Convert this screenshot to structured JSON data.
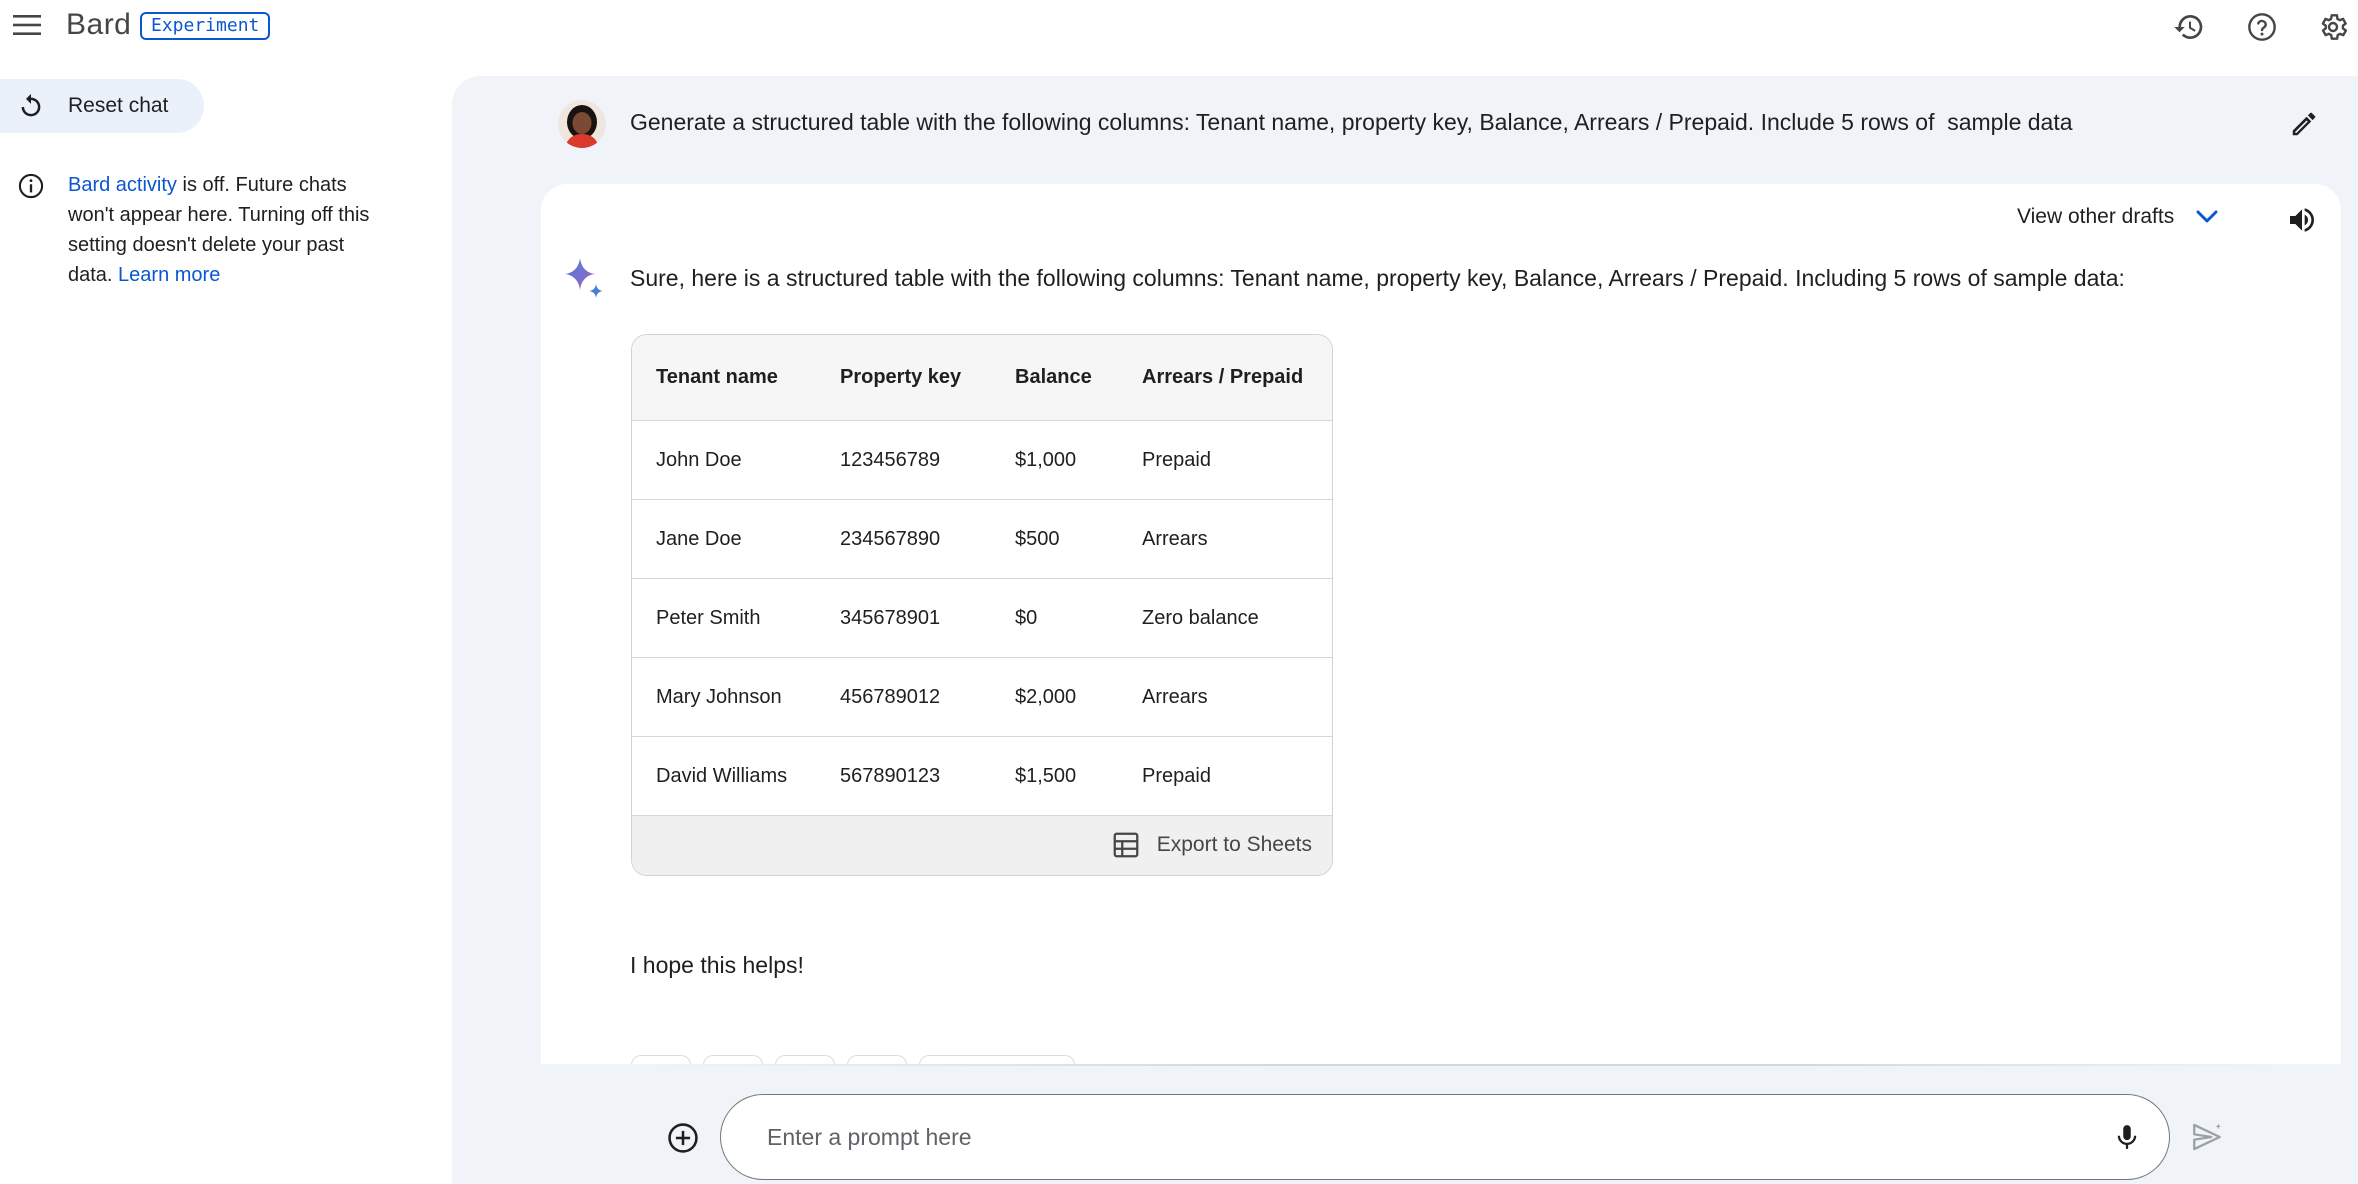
{
  "header": {
    "menu_icon": "hamburger-menu-icon",
    "brand": "Bard",
    "badge": "Experiment",
    "icons": [
      "history-icon",
      "help-icon",
      "settings-icon"
    ]
  },
  "sidebar": {
    "reset_label": "Reset chat",
    "activity_link": "Bard activity",
    "activity_text": " is off. Future chats won't appear here. Turning off this setting doesn't delete your past data. ",
    "learn_more": "Learn more"
  },
  "chat": {
    "user_prompt": "Generate a structured table with the following columns: Tenant name, property key, Balance, Arrears / Prepaid. Include 5 rows of  sample data",
    "drafts_label": "View other drafts",
    "response_intro": "Sure, here is a structured table with the following columns: Tenant name, property key, Balance, Arrears / Prepaid. Including 5 rows of sample data:",
    "table": {
      "headers": [
        "Tenant name",
        "Property key",
        "Balance",
        "Arrears / Prepaid"
      ],
      "rows": [
        [
          "John Doe",
          "123456789",
          "$1,000",
          "Prepaid"
        ],
        [
          "Jane Doe",
          "234567890",
          "$500",
          "Arrears"
        ],
        [
          "Peter Smith",
          "345678901",
          "$0",
          "Zero balance"
        ],
        [
          "Mary Johnson",
          "456789012",
          "$2,000",
          "Arrears"
        ],
        [
          "David Williams",
          "567890123",
          "$1,500",
          "Prepaid"
        ]
      ],
      "export_label": "Export to Sheets"
    },
    "response_outro": "I hope this helps!"
  },
  "input": {
    "placeholder": "Enter a prompt here"
  },
  "colors": {
    "accent": "#0b57d0",
    "panel_bg": "#f0f4f9",
    "reset_bg": "#eaf1fb"
  }
}
